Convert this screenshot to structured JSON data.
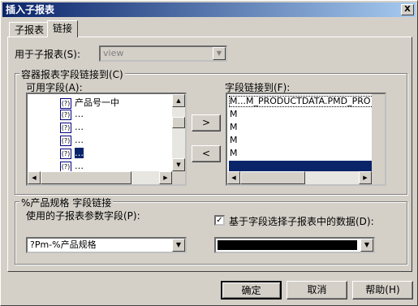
{
  "window": {
    "title": "插入子报表",
    "close_glyph": "X"
  },
  "tabs": [
    {
      "label": "子报表"
    },
    {
      "label": "链接"
    }
  ],
  "subreport": {
    "label": "用于子报表(S):",
    "value": "view"
  },
  "link_group": {
    "title": "容器报表字段链接到(C)",
    "available_label": "可用字段(A):",
    "linked_label": "字段链接到(F):",
    "available_items": [
      {
        "icon": "(?)",
        "text": "产品号一中"
      },
      {
        "icon": "(?)",
        "text": "…"
      },
      {
        "icon": "(?)",
        "text": "…"
      },
      {
        "icon": "(?)",
        "text": "…"
      },
      {
        "icon": "(?)",
        "text": "…"
      },
      {
        "icon": "(?)",
        "text": "…"
      }
    ],
    "linked_items": [
      {
        "text": "M...M_PRODUCTDATA.PMD_PRO"
      },
      {
        "text": "M"
      },
      {
        "text": "M"
      },
      {
        "text": "M"
      },
      {
        "text": "M"
      },
      {
        "text": ""
      }
    ],
    "add_button": ">",
    "remove_button": "<"
  },
  "param_group": {
    "title": "%产品规格 字段链接",
    "param_label": "使用的子报表参数字段(P):",
    "param_value": "?Pm-%产品规格",
    "checkbox_label": "基于字段选择子报表中的数据(D):",
    "checkbox_checked": "✓",
    "data_field_value": ""
  },
  "buttons": {
    "ok": "确定",
    "cancel": "取消",
    "help": "帮助(H)"
  }
}
